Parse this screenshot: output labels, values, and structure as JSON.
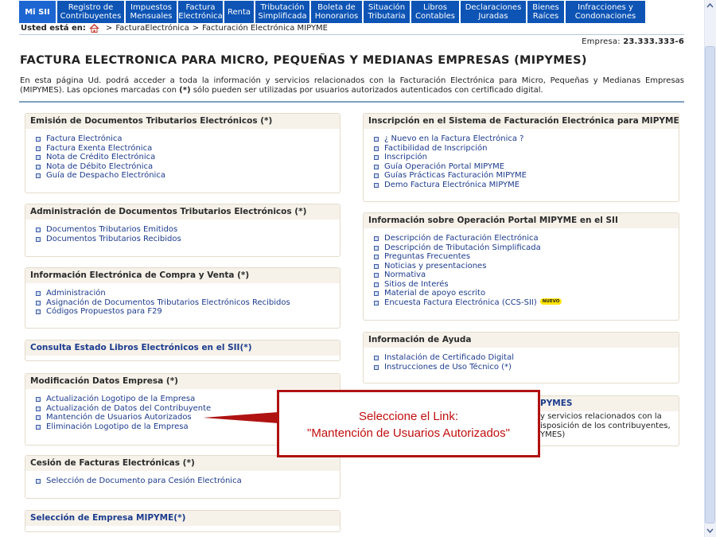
{
  "nav": {
    "items": [
      {
        "label": "Mi SII"
      },
      {
        "label": "Registro de Contribuyentes"
      },
      {
        "label": "Impuestos Mensuales"
      },
      {
        "label": "Factura Electrónica"
      },
      {
        "label": "Renta"
      },
      {
        "label": "Tributación Simplificada"
      },
      {
        "label": "Boleta de Honorarios"
      },
      {
        "label": "Situación Tributaria"
      },
      {
        "label": "Libros Contables"
      },
      {
        "label": "Declaraciones Juradas"
      },
      {
        "label": "Bienes Raíces"
      },
      {
        "label": "Infracciones y Condonaciones"
      }
    ]
  },
  "breadcrumb": {
    "label": "Usted está en:",
    "items": [
      "FacturaElectrónica",
      "Facturación Electrónica MIPYME"
    ]
  },
  "empresa": {
    "label": "Empresa:",
    "rut": "23.333.333-6"
  },
  "page": {
    "title": "FACTURA ELECTRONICA PARA MICRO, PEQUEÑAS Y MEDIANAS EMPRESAS (MIPYMES)",
    "intro_part1": "En esta página Ud. podrá acceder a toda la información y servicios relacionados con la Facturación Electrónica para Micro, Pequeñas y Medianas Empresas (MIPYMES). Las opciones marcadas con ",
    "intro_mark": "(*)",
    "intro_part2": " sólo pueden ser utilizadas por usuarios autorizados autenticados con certificado digital."
  },
  "boxes": {
    "emision": {
      "title": "Emisión de Documentos Tributarios Electrónicos (*)",
      "items": [
        "Factura Electrónica",
        "Factura Exenta Electrónica",
        "Nota de Crédito Electrónica",
        "Nota de Débito Electrónica",
        "Guía de Despacho Electrónica"
      ]
    },
    "administracion": {
      "title": "Administración de Documentos Tributarios Electrónicos (*)",
      "items": [
        "Documentos Tributarios Emitidos",
        "Documentos Tributarios Recibidos"
      ]
    },
    "compra_venta": {
      "title": "Información Electrónica de Compra y Venta (*)",
      "items": [
        "Administración",
        "Asignación de Documentos Tributarios Electrónicos Recibidos",
        "Códigos Propuestos para F29"
      ]
    },
    "libros": {
      "title": "Consulta Estado Libros Electrónicos en el SII(*)"
    },
    "modificacion": {
      "title": "Modificación Datos Empresa (*)",
      "items": [
        "Actualización Logotipo de la Empresa",
        "Actualización de Datos del Contribuyente",
        "Mantención de Usuarios Autorizados",
        "Eliminación Logotipo de la Empresa"
      ]
    },
    "cesion": {
      "title": "Cesión de Facturas Electrónicas (*)",
      "items": [
        "Selección de Documento para Cesión Electrónica"
      ]
    },
    "seleccion": {
      "title": "Selección de Empresa MIPYME(*)"
    },
    "inscripcion": {
      "title": "Inscripción en el Sistema de Facturación Electrónica para MIPYMES",
      "items": [
        "¿ Nuevo en la Factura Electrónica ?",
        "Factibilidad de Inscripción",
        "Inscripción",
        "Guía Operación Portal MIPYME",
        "Guías Prácticas Facturación MIPYME",
        "Demo Factura Electrónica MIPYME"
      ]
    },
    "operacion": {
      "title": "Información sobre Operación Portal MIPYME en el SII",
      "items": [
        "Descripción de Facturación Electrónica",
        "Descripción de Tributación Simplificada",
        "Preguntas Frecuentes",
        "Noticias y presentaciones",
        "Normativa",
        "Sitios de Interés",
        "Material de apoyo escrito",
        "Encuesta Factura Electrónica (CCS-SII)"
      ],
      "new_badge": "NUEVO"
    },
    "ayuda": {
      "title": "Información de Ayuda",
      "items": [
        "Instalación de Certificado Digital",
        "Instrucciones de Uso Técnico (*)"
      ]
    },
    "partial": {
      "title_fragment": "PYMES",
      "lines": [
        "y servicios relacionados con la",
        "isposición de los contribuyentes,",
        "YMES)"
      ]
    }
  },
  "callout": {
    "line1": "Seleccione el Link:",
    "line2": "\"Mantención de Usuarios Autorizados\"",
    "color": "#c10e0e"
  },
  "colors": {
    "nav_bg": "#0d54b5",
    "link": "#1c3b8c",
    "box_header": "#f6f2ea"
  }
}
